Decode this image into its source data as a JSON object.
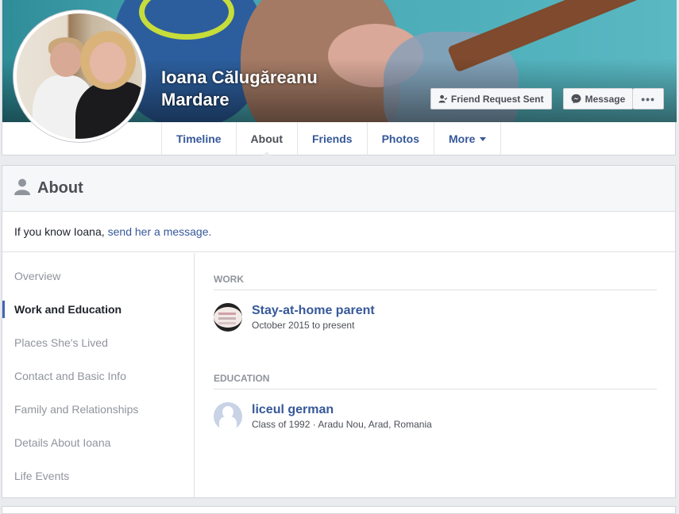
{
  "profile": {
    "name_line1": "Ioana Călugăreanu",
    "name_line2": "Mardare",
    "friend_request_label": "Friend Request Sent",
    "message_label": "Message",
    "more_label": "•••"
  },
  "tabs": [
    {
      "label": "Timeline"
    },
    {
      "label": "About"
    },
    {
      "label": "Friends"
    },
    {
      "label": "Photos"
    },
    {
      "label": "More"
    }
  ],
  "about": {
    "title": "About",
    "know_text": "If you know Ioana,",
    "know_link": "send her a message."
  },
  "side_nav": [
    {
      "label": "Overview"
    },
    {
      "label": "Work and Education"
    },
    {
      "label": "Places She's Lived"
    },
    {
      "label": "Contact and Basic Info"
    },
    {
      "label": "Family and Relationships"
    },
    {
      "label": "Details About Ioana"
    },
    {
      "label": "Life Events"
    }
  ],
  "work": {
    "section_label": "WORK",
    "title": "Stay-at-home parent",
    "subtitle": "October 2015 to present"
  },
  "education": {
    "section_label": "EDUCATION",
    "title": "liceul german",
    "subtitle": "Class of 1992 · Aradu Nou, Arad, Romania"
  },
  "colors": {
    "link": "#365899",
    "accent": "#4267b2",
    "page_bg": "#e9ebee"
  }
}
